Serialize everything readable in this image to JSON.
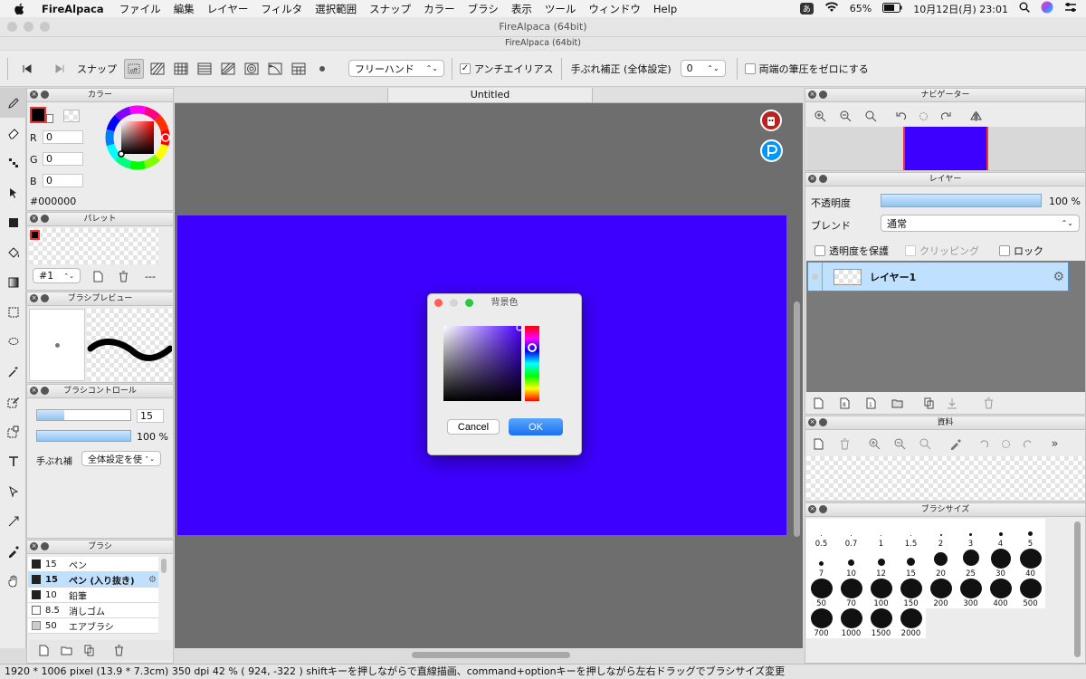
{
  "menubar": {
    "app": "FireAlpaca",
    "items": [
      "ファイル",
      "編集",
      "レイヤー",
      "フィルタ",
      "選択範囲",
      "スナップ",
      "カラー",
      "ブラシ",
      "表示",
      "ツール",
      "ウィンドウ",
      "Help"
    ],
    "input_mode": "あ",
    "battery": "65%",
    "datetime": "10月12日(月)  23:01"
  },
  "window": {
    "title": "FireAlpaca (64bit)",
    "subtitle": "FireAlpaca (64bit)"
  },
  "toolbar": {
    "snap_label": "スナップ",
    "brush_mode": "フリーハンド",
    "antialias_label": "アンチエイリアス",
    "stabilizer_label": "手ぶれ補正 (全体設定)",
    "stabilizer_value": "0",
    "pressure_label": "両端の筆圧をゼロにする"
  },
  "color_panel": {
    "title": "カラー",
    "r_label": "R",
    "r": "0",
    "g_label": "G",
    "g": "0",
    "b_label": "B",
    "b": "0",
    "hex": "#000000",
    "fg_color": "#000000"
  },
  "palette_panel": {
    "title": "パレット",
    "selector": "#1",
    "more": "---"
  },
  "brush_preview_panel": {
    "title": "ブラシプレビュー"
  },
  "brush_control_panel": {
    "title": "ブラシコントロール",
    "size": "15",
    "opacity": "100 %",
    "stabilizer_label": "手ぶれ補",
    "stabilizer_value": "全体設定を使"
  },
  "brush_panel": {
    "title": "ブラシ",
    "items": [
      {
        "size": "15",
        "name": "ペン",
        "selected": false
      },
      {
        "size": "15",
        "name": "ペン (入り抜き)",
        "selected": true
      },
      {
        "size": "10",
        "name": "鉛筆",
        "selected": false
      },
      {
        "size": "8.5",
        "name": "消しゴム",
        "selected": false
      },
      {
        "size": "50",
        "name": "エアブラシ",
        "selected": false
      }
    ]
  },
  "canvas": {
    "tab": "Untitled",
    "color": "#3d00ff"
  },
  "dialog": {
    "title": "背景色",
    "cancel": "Cancel",
    "ok": "OK"
  },
  "navigator_panel": {
    "title": "ナビゲーター"
  },
  "layer_panel": {
    "title": "レイヤー",
    "opacity_label": "不透明度",
    "opacity_value": "100 %",
    "opacity_fraction": 1.0,
    "blend_label": "ブレンド",
    "blend_value": "通常",
    "protect_label": "透明度を保護",
    "clipping_label": "クリッピング",
    "lock_label": "ロック",
    "layer_name": "レイヤー1"
  },
  "material_panel": {
    "title": "資料"
  },
  "brush_size_panel": {
    "title": "ブラシサイズ",
    "sizes": [
      "0.5",
      "0.7",
      "1",
      "1.5",
      "2",
      "3",
      "4",
      "5",
      "7",
      "10",
      "12",
      "15",
      "20",
      "25",
      "30",
      "40",
      "50",
      "70",
      "100",
      "150",
      "200",
      "300",
      "400",
      "500",
      "700",
      "1000",
      "1500",
      "2000"
    ]
  },
  "statusbar": {
    "text": "1920 * 1006 pixel   (13.9 * 7.3cm)   350 dpi   42 %   ( 924, -322 )   shiftキーを押しながらで直線描画、command+optionキーを押しながら左右ドラッグでブラシサイズ変更"
  }
}
